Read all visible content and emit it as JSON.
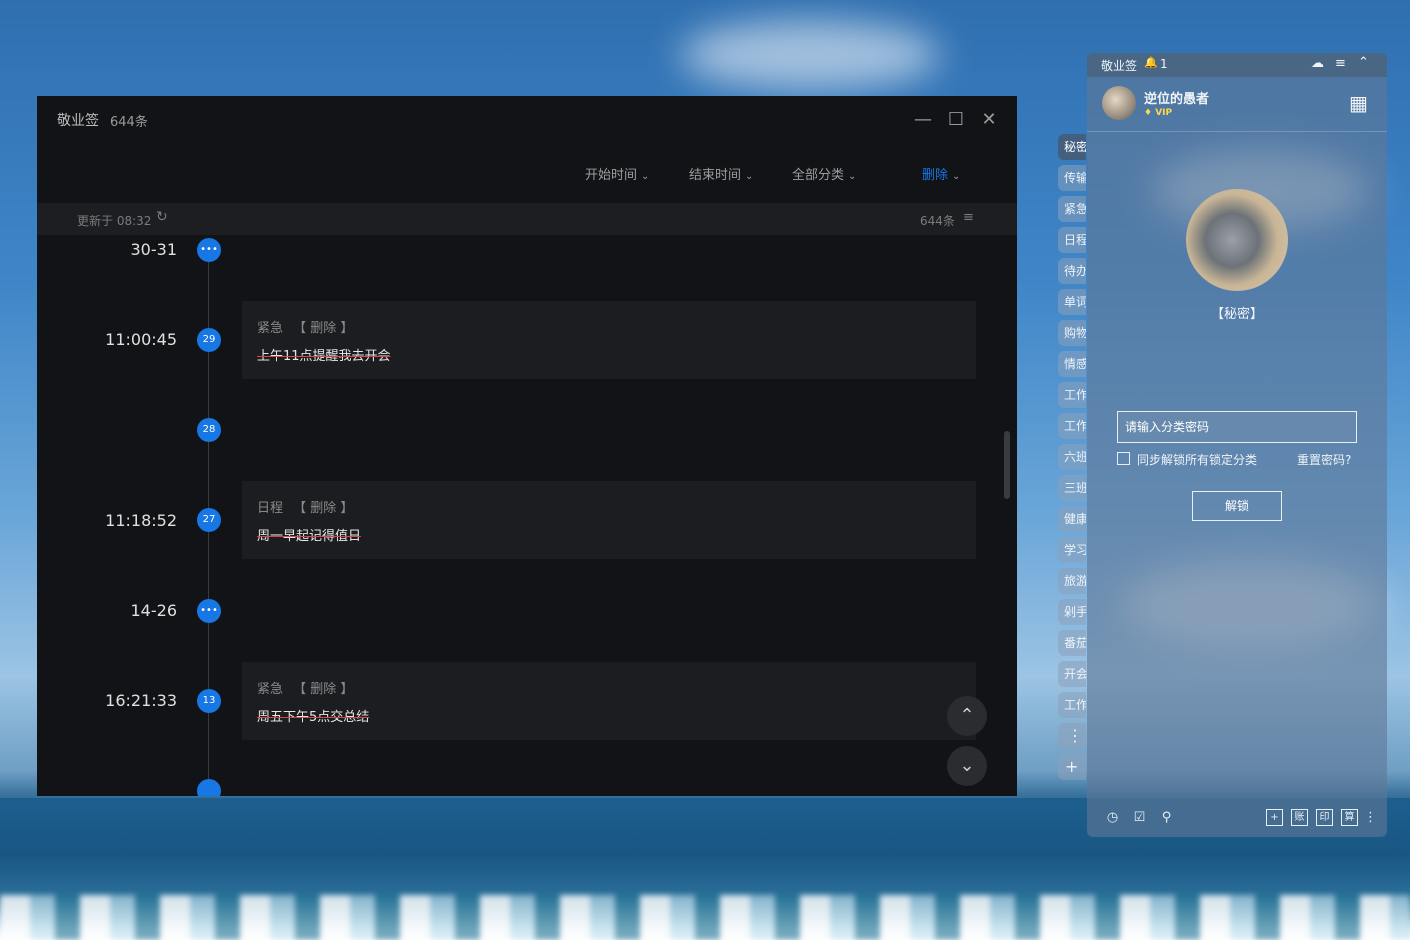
{
  "main_window": {
    "title": "敬业签",
    "count": "644条",
    "filters": {
      "start_time": "开始时间",
      "end_time": "结束时间",
      "category": "全部分类",
      "delete": "删除"
    },
    "update_text": "更新于 08:32",
    "total": "644条",
    "timeline": [
      {
        "time": "30-31",
        "badge": "•••"
      },
      {
        "time": "11:00:45",
        "badge": "29",
        "tag": "紧急",
        "action": "【 删除 】",
        "text": "上午11点提醒我去开会"
      },
      {
        "time": "",
        "badge": "28"
      },
      {
        "time": "11:18:52",
        "badge": "27",
        "tag": "日程",
        "action": "【 删除 】",
        "text": "周一早起记得值日"
      },
      {
        "time": "14-26",
        "badge": "•••"
      },
      {
        "time": "16:21:33",
        "badge": "13",
        "tag": "紧急",
        "action": "【 删除 】",
        "text": "周五下午5点交总结"
      }
    ]
  },
  "side_panel": {
    "app_name": "敬业签",
    "notification_count": "1",
    "username": "逆位的愚者",
    "vip_label": "VIP",
    "category_title": "【秘密】",
    "password_placeholder": "请输入分类密码",
    "sync_checkbox_label": "同步解锁所有锁定分类",
    "reset_password": "重置密码?",
    "unlock_button": "解锁",
    "tabs": [
      "秘密",
      "传输",
      "紧急",
      "日程",
      "待办",
      "单词",
      "购物",
      "情感",
      "工作",
      "工作",
      "六班",
      "三班",
      "健康",
      "学习",
      "旅游",
      "剁手",
      "番茄",
      "开会",
      "工作"
    ],
    "footer_boxes": [
      "+",
      "账",
      "印",
      "算"
    ]
  },
  "colors": {
    "accent": "#1677e5",
    "strike": "#d24848"
  }
}
